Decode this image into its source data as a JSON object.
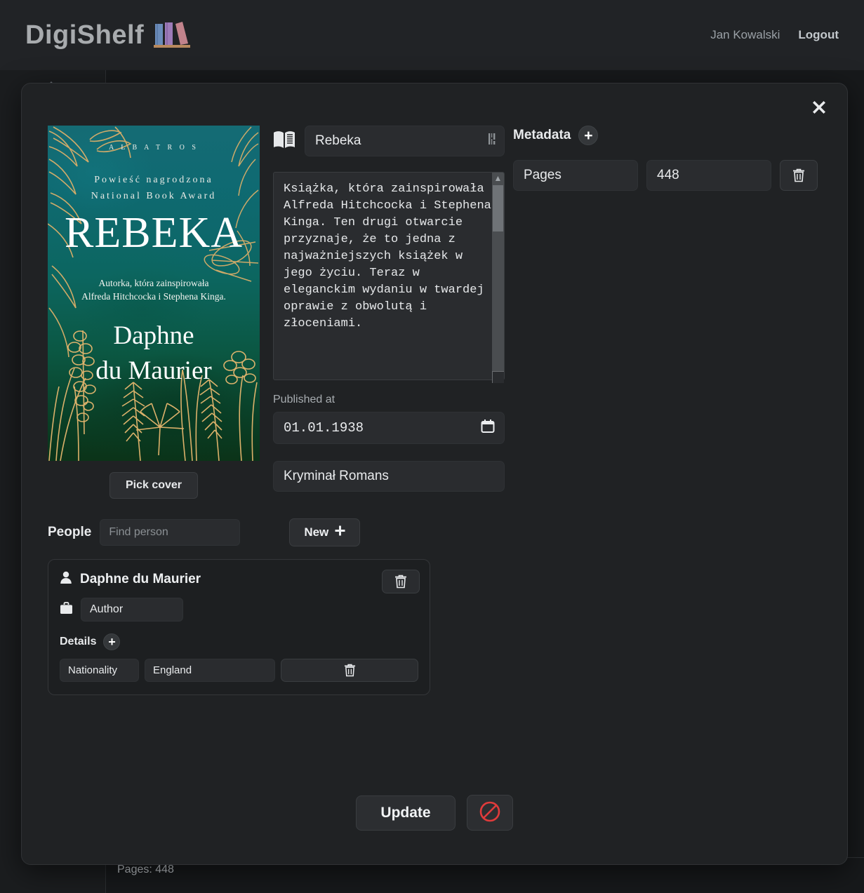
{
  "header": {
    "brand": "DigiShelf",
    "logo_icon": "books-logo-icon",
    "user_name": "Jan Kowalski",
    "logout_label": "Logout",
    "brand_color": "#a8abae"
  },
  "background": {
    "pages_summary": "Pages: 448",
    "caret_icon": "caret-up-icon"
  },
  "modal": {
    "close_icon": "close-icon",
    "cover": {
      "pick_cover_label": "Pick cover",
      "publisher": "A L B A T R O S",
      "award_line_1": "Powieść nagrodzona",
      "award_line_2": "National Book Award",
      "title": "REBEKA",
      "subtitle_line_1": "Autorka, która zainspirowała",
      "subtitle_line_2": "Alfreda Hitchcocka i Stephena Kinga.",
      "author_line_1": "Daphne",
      "author_line_2": "du Maurier",
      "accent_gold": "#e2b169",
      "accent_teal": "#0f6a72"
    },
    "details": {
      "book_icon": "open-book-icon",
      "title_value": "Rebeka",
      "title_badge_icon": "barcode-icon",
      "description_value": "Książka, która zainspirowała Alfreda Hitchcocka i Stephena Kinga. Ten drugi otwarcie przyznaje, że to jedna z najważniejszych książek w jego życiu. Teraz w eleganckim wydaniu w twardej oprawie z obwolutą i złoceniami.",
      "published_at_label": "Published at",
      "published_at_value": "01.01.1938",
      "calendar_icon": "calendar-icon",
      "genre_value": "Kryminał Romans",
      "scrollbar_up_icon": "chevron-up-icon",
      "scrollbar_down_icon": "chevron-down-icon",
      "resize_grip_icon": "resize-grip-icon"
    },
    "metadata": {
      "section_label": "Metadata",
      "add_icon": "plus-icon",
      "rows": [
        {
          "key": "Pages",
          "value": "448",
          "delete_icon": "trash-icon"
        }
      ]
    },
    "people": {
      "section_label": "People",
      "find_placeholder": "Find person",
      "find_value": "",
      "new_label": "New",
      "new_icon": "plus-icon",
      "cards": [
        {
          "person_icon": "person-icon",
          "name": "Daphne du Maurier",
          "delete_icon": "trash-icon",
          "role_icon": "briefcase-icon",
          "role": "Author",
          "details_label": "Details",
          "details_add_icon": "plus-icon",
          "details": [
            {
              "key": "Nationality",
              "value": "England",
              "delete_icon": "trash-icon"
            }
          ]
        }
      ]
    },
    "actions": {
      "update_label": "Update",
      "cancel_icon": "no-entry-icon",
      "cancel_color": "#e03b3b"
    }
  }
}
